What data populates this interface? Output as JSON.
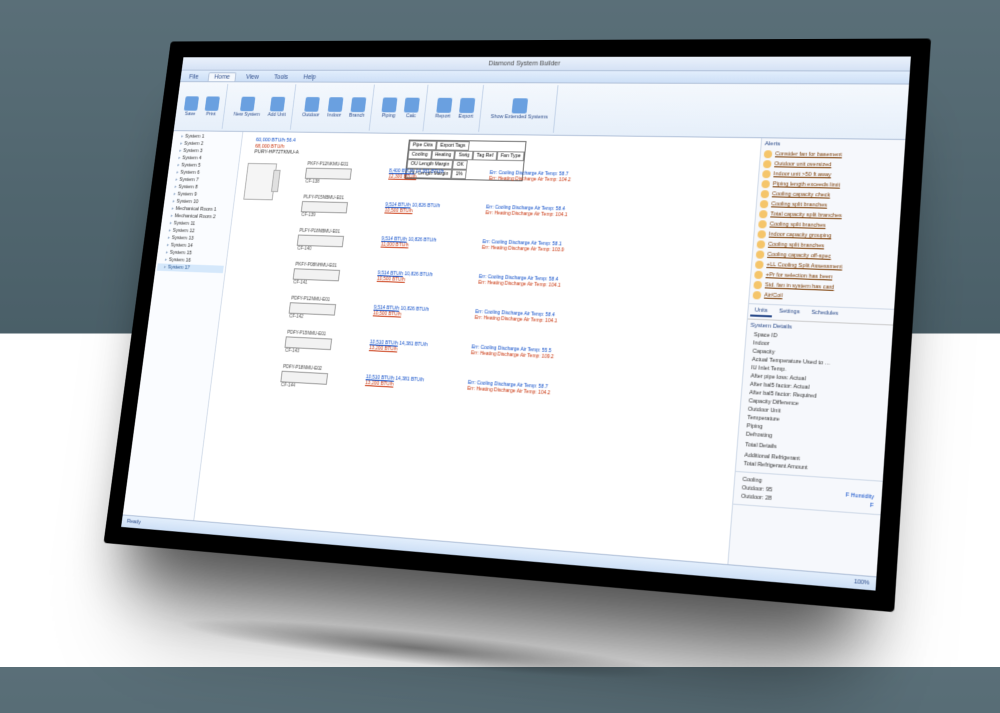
{
  "title": "Diamond System Builder",
  "ribbon": {
    "tabs": [
      "File",
      "Home",
      "View",
      "Tools",
      "Help"
    ],
    "active": 1,
    "groups": [
      {
        "buttons": [
          {
            "label": "Save"
          },
          {
            "label": "Print"
          }
        ]
      },
      {
        "buttons": [
          {
            "label": "New System"
          },
          {
            "label": "Add Unit"
          }
        ]
      },
      {
        "buttons": [
          {
            "label": "Outdoor"
          },
          {
            "label": "Indoor"
          },
          {
            "label": "Branch"
          }
        ]
      },
      {
        "buttons": [
          {
            "label": "Piping"
          },
          {
            "label": "Calc"
          }
        ]
      },
      {
        "buttons": [
          {
            "label": "Report"
          },
          {
            "label": "Export"
          }
        ]
      },
      {
        "buttons": [
          {
            "label": "Show Extended Systems"
          }
        ]
      }
    ]
  },
  "tree": {
    "items": [
      "System 1",
      "System 2",
      "System 3",
      "System 4",
      "System 5",
      "System 6",
      "System 7",
      "System 8",
      "System 9",
      "System 10",
      "Mechanical Room 1",
      "Mechanical Room 2",
      "System 11",
      "System 12",
      "System 13",
      "System 14",
      "System 15",
      "System 16",
      "System 17"
    ],
    "active": 18
  },
  "tags_box": {
    "rows": [
      [
        "Pipe Ckts",
        "Export Tags"
      ],
      [
        "Cooling",
        "Heating",
        "Swtg",
        "Tag Ref",
        "Fan Type"
      ],
      [
        "OU Length Margin",
        "OK"
      ],
      [
        "OU Length Margin",
        "1%"
      ]
    ],
    "err1": "Err: Cooling Discharge Air Temp",
    "err2": "Err: Heating Discharge Air Temp"
  },
  "outdoor": {
    "model": "PURY-HP72TKMU-A",
    "cool": "60,000 BTU/h 56.4",
    "heat": "68,000 BTU/h"
  },
  "branches": [
    {
      "model": "PKFY-P12NKMU-E01",
      "sub": "CF-138",
      "cool_btu": "8,400 BTU/h",
      "heat_btu": "12,300 BTU/h",
      "cool_cap": "14,381 BTU/h",
      "heat_cap": "14,381 BTU/h",
      "c_temp": "58.7",
      "h_temp": "104.2"
    },
    {
      "model": "PLFY-P15NBMU-E01",
      "sub": "CF-139",
      "cool_btu": "9,514 BTU/h",
      "heat_btu": "10,500 BTU/h",
      "cool_cap": "10,826 BTU/h",
      "heat_cap": "10,826 BTU/h",
      "c_temp": "58.4",
      "h_temp": "104.1"
    },
    {
      "model": "PLFY-P18NBMU-E01",
      "sub": "CF-140",
      "cool_btu": "9,514 BTU/h",
      "heat_btu": "11,000 BTU/h",
      "cool_cap": "10,826 BTU/h",
      "heat_cap": "10,826 BTU/h",
      "c_temp": "58.1",
      "h_temp": "103.9"
    },
    {
      "model": "PKFY-P08NHMU-E01",
      "sub": "CF-141",
      "cool_btu": "9,514 BTU/h",
      "heat_btu": "10,500 BTU/h",
      "cool_cap": "10,826 BTU/h",
      "heat_cap": "10,826 BTU/h",
      "c_temp": "58.4",
      "h_temp": "104.1"
    },
    {
      "model": "PDFY-P12NMU-E01",
      "sub": "CF-142",
      "cool_btu": "9,514 BTU/h",
      "heat_btu": "10,500 BTU/h",
      "cool_cap": "10,826 BTU/h",
      "heat_cap": "10,826 BTU/h",
      "c_temp": "58.4",
      "h_temp": "104.1"
    },
    {
      "model": "PDFY-P15NMU-E01",
      "sub": "CF-143",
      "cool_btu": "10,510 BTU/h",
      "heat_btu": "13,200 BTU/h",
      "cool_cap": "14,381 BTU/h",
      "heat_cap": "14,381 BTU/h",
      "c_temp": "55.5",
      "h_temp": "109.2"
    },
    {
      "model": "PDFY-P18NMU-E02",
      "sub": "CF-144",
      "cool_btu": "10,510 BTU/h",
      "heat_btu": "13,200 BTU/h",
      "cool_cap": "14,381 BTU/h",
      "heat_cap": "14,381 BTU/h",
      "c_temp": "58.7",
      "h_temp": "104.2"
    }
  ],
  "alerts": {
    "title": "Alerts",
    "items": [
      "Consider fan for basement",
      "Outdoor unit oversized",
      "Indoor unit >50 ft away",
      "Piping length exceeds limit",
      "Cooling capacity check",
      "Cooling split branches",
      "Total capacity split branches",
      "Cooling split branches",
      "Indoor capacity grouping",
      "Cooling split branches",
      "Cooling capacity off-spec",
      "+LL Cooling Split Assessment",
      "+Pr for selection has been",
      "Std. fan in system has card",
      "Air/Coil"
    ]
  },
  "properties": {
    "tabs": [
      "Units",
      "Settings",
      "Schedules"
    ],
    "active": 0,
    "title": "System Details",
    "rows": [
      {
        "k": "Space ID",
        "v": ""
      },
      {
        "k": "Indoor",
        "v": ""
      },
      {
        "k": "Capacity",
        "v": ""
      },
      {
        "k": "Actual Temperature Used to …",
        "v": ""
      },
      {
        "k": "IU Inlet Temp.",
        "v": ""
      },
      {
        "k": "After pipe loss: Actual",
        "v": ""
      },
      {
        "k": "After bal5 factor: Actual",
        "v": ""
      },
      {
        "k": "After bal5 factor: Required",
        "v": ""
      },
      {
        "k": "Capacity Difference",
        "v": ""
      },
      {
        "k": "Outdoor Unit",
        "v": ""
      },
      {
        "k": "Temperature",
        "v": ""
      },
      {
        "k": "Piping",
        "v": ""
      },
      {
        "k": "Defrosting",
        "v": ""
      },
      {
        "k": "",
        "v": ""
      },
      {
        "k": "Total Details",
        "v": ""
      },
      {
        "k": "",
        "v": ""
      },
      {
        "k": "Additional Refrigerant",
        "v": ""
      },
      {
        "k": "Total Refrigerant Amount",
        "v": ""
      }
    ],
    "foot": [
      {
        "k": "Cooling",
        "v": ""
      },
      {
        "k": "Outdoor: 95",
        "v": "F    Humidity"
      },
      {
        "k": "Outdoor: 28",
        "v": "F"
      }
    ]
  },
  "status": {
    "left": "Ready",
    "right": "100%"
  }
}
